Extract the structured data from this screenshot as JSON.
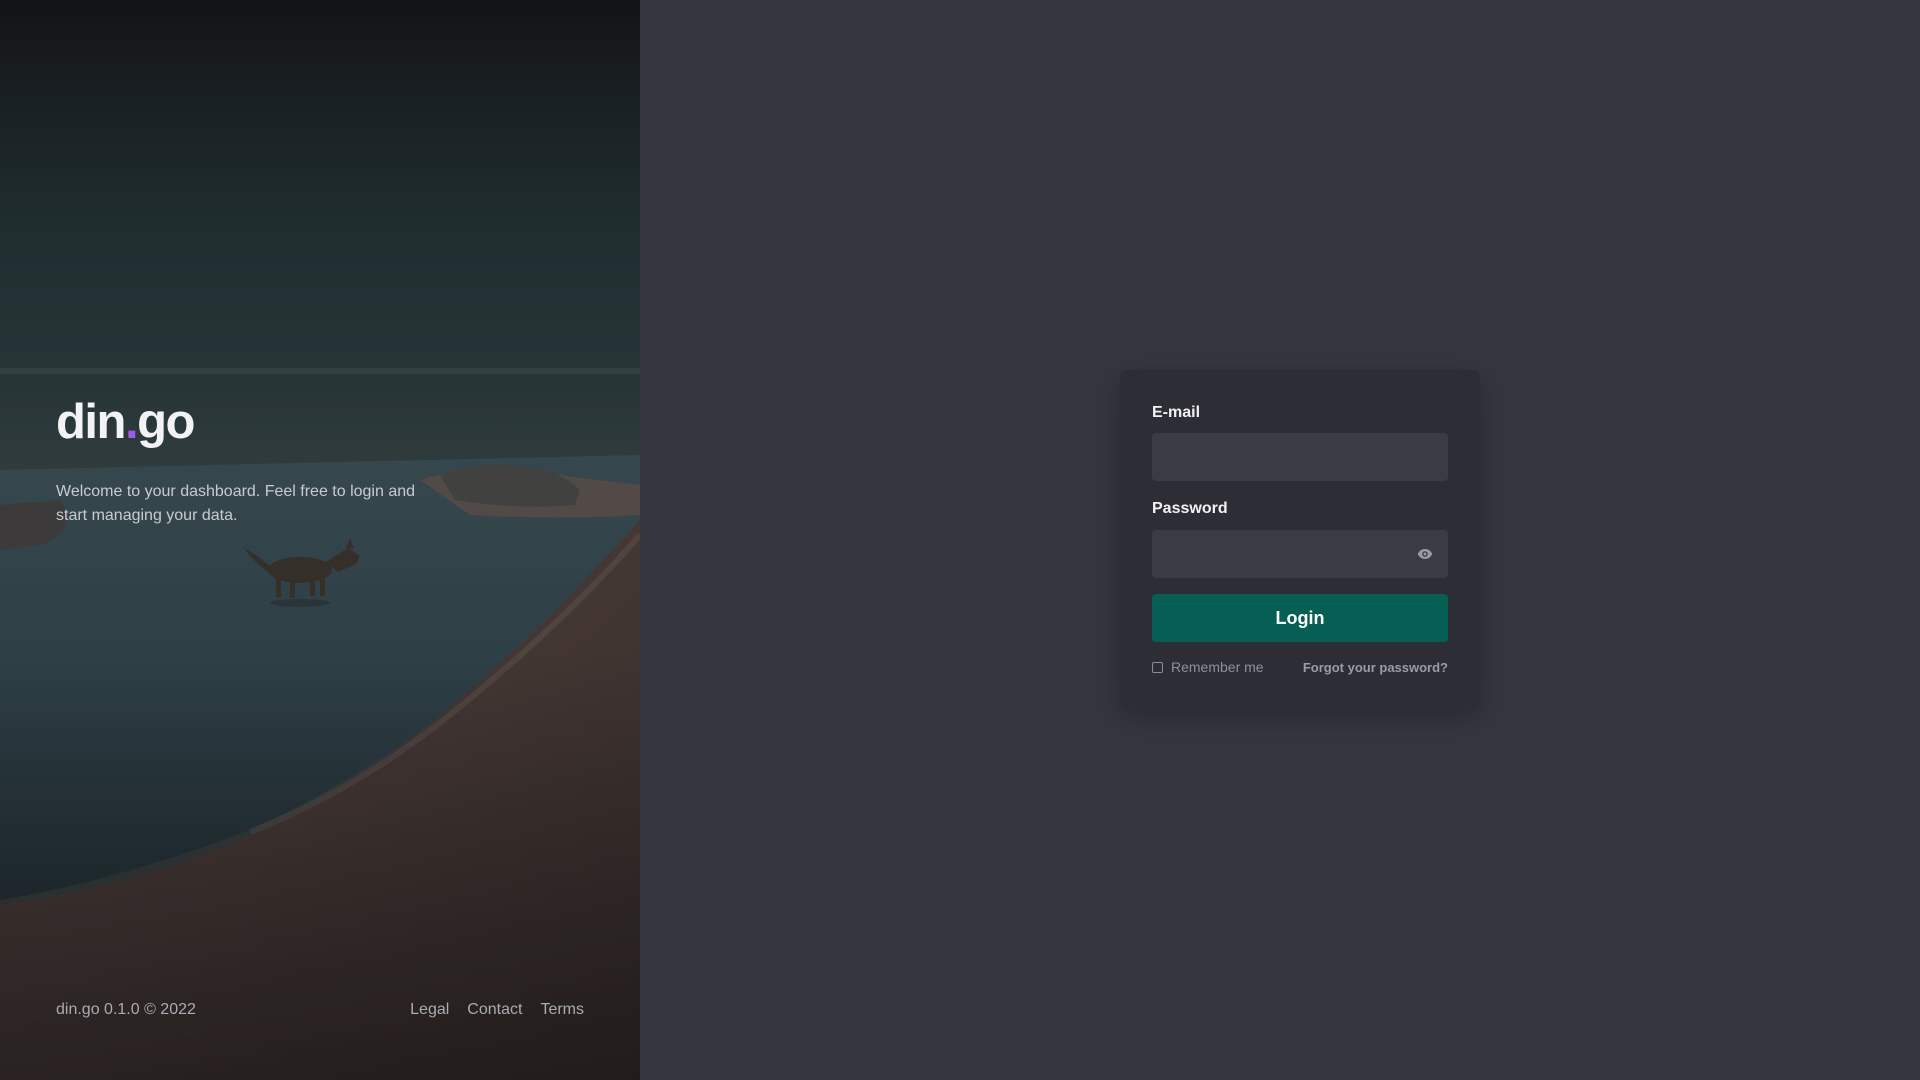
{
  "hero": {
    "brand_name_part1": "din",
    "brand_dot": ".",
    "brand_name_part2": "go",
    "tagline": "Welcome to your dashboard. Feel free to login and start managing your data.",
    "footer_text": "din.go 0.1.0 © 2022",
    "links": [
      "Legal",
      "Contact",
      "Terms"
    ]
  },
  "login_form": {
    "email_label": "E-mail",
    "email_value": "",
    "password_label": "Password",
    "password_value": "",
    "password_toggle_icon": "eye-icon",
    "login_label": "Login",
    "remember_label": "Remember me",
    "remember_checked": false,
    "forgot_label": "Forgot your password?"
  },
  "colors": {
    "page_background": "#363640",
    "card_background": "#2d2d35",
    "input_background": "#3b3b43",
    "primary_button": "#075e54",
    "brand_accent": "#9b5de5"
  }
}
